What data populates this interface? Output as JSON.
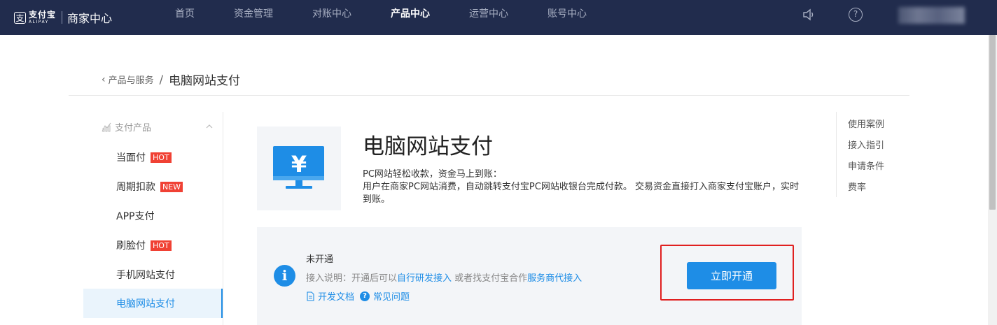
{
  "header": {
    "logo_mark": "支",
    "logo_cn": "支付宝",
    "logo_en": "ALIPAY",
    "app_name": "商家中心",
    "nav": [
      "首页",
      "资金管理",
      "对账中心",
      "产品中心",
      "运营中心",
      "账号中心"
    ],
    "active_nav": "产品中心",
    "icons": [
      "speaker-icon",
      "help-icon"
    ],
    "help_glyph": "?"
  },
  "breadcrumb": {
    "back_label": "产品与服务",
    "separator": "/",
    "current": "电脑网站支付"
  },
  "sidebar": {
    "group_label": "支付产品",
    "items": [
      {
        "label": "当面付",
        "tag": "HOT"
      },
      {
        "label": "周期扣款",
        "tag": "NEW"
      },
      {
        "label": "APP支付",
        "tag": ""
      },
      {
        "label": "刷脸付",
        "tag": "HOT"
      },
      {
        "label": "手机网站支付",
        "tag": ""
      },
      {
        "label": "电脑网站支付",
        "tag": ""
      }
    ],
    "active_item": "电脑网站支付"
  },
  "product": {
    "title": "电脑网站支付",
    "desc_line1": "PC网站轻松收款，资金马上到账：",
    "desc_line2": "用户在商家PC网站消费，自动跳转支付宝PC网站收银台完成付款。 交易资金直接打入商家支付宝账户，实时到账。",
    "icon": "yen-monitor-icon",
    "icon_symbol": "¥"
  },
  "anchors": [
    "使用案例",
    "接入指引",
    "申请条件",
    "费率"
  ],
  "status": {
    "info_glyph": "i",
    "title": "未开通",
    "desc_prefix": "接入说明：开通后可以",
    "link1": "自行研发接入",
    "desc_mid": " 或者找支付宝合作",
    "link2": "服务商代接入",
    "doc_link": "开发文档",
    "faq_glyph": "?",
    "faq_link": "常见问题",
    "button": "立即开通"
  },
  "colors": {
    "topbar": "#212c4d",
    "accent": "#1e8de6",
    "tag": "#f04134",
    "highlight": "#e02020"
  }
}
